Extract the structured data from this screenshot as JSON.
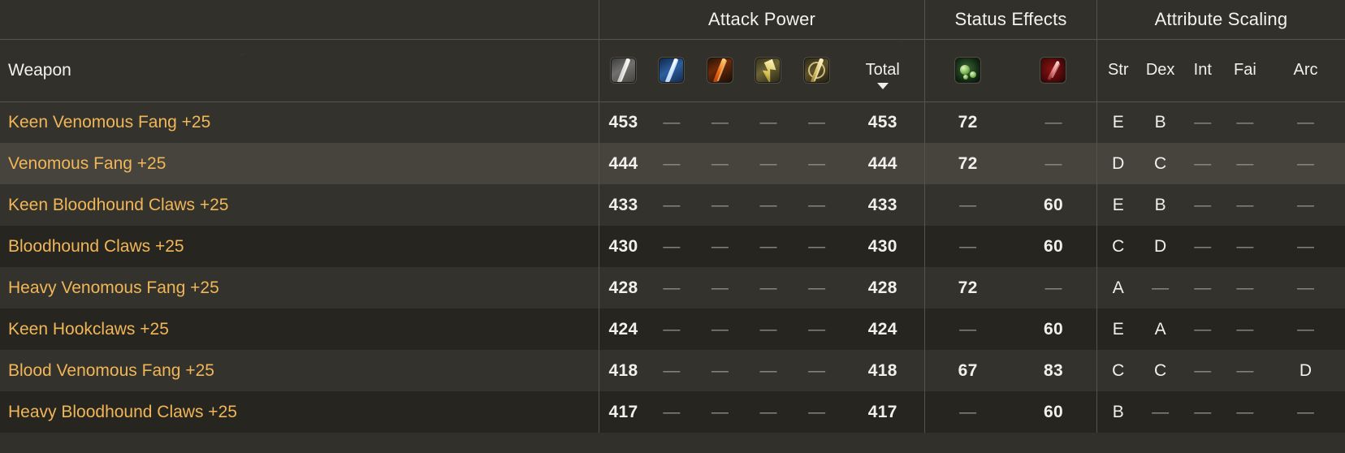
{
  "theme": {
    "background": "#32302a",
    "row_odd": "#34322c",
    "row_even": "#262520",
    "row_hover": "#46443c",
    "border": "#56534a",
    "text": "#f2f0ea",
    "weapon_name": "#f0b657",
    "dash": "#8f8c82"
  },
  "header": {
    "weapon_column_label": "Weapon",
    "groups": [
      {
        "label": "Attack Power"
      },
      {
        "label": "Status Effects"
      },
      {
        "label": "Attribute Scaling"
      }
    ],
    "attack_power_columns": [
      {
        "icon": "physical-damage-icon",
        "label": ""
      },
      {
        "icon": "magic-damage-icon",
        "label": ""
      },
      {
        "icon": "fire-damage-icon",
        "label": ""
      },
      {
        "icon": "lightning-damage-icon",
        "label": ""
      },
      {
        "icon": "holy-damage-icon",
        "label": ""
      },
      {
        "icon": "",
        "label": "Total",
        "sorted": true,
        "sort_direction": "descending"
      }
    ],
    "status_effect_columns": [
      {
        "icon": "poison-status-icon",
        "label": ""
      },
      {
        "icon": "bleed-status-icon",
        "label": ""
      }
    ],
    "attribute_columns": [
      "Str",
      "Dex",
      "Int",
      "Fai",
      "Arc"
    ]
  },
  "rows": [
    {
      "weapon": "Keen Venomous Fang +25",
      "striping": "odd",
      "attack": [
        "453",
        "—",
        "—",
        "—",
        "—"
      ],
      "total": "453",
      "status": [
        "72",
        "—"
      ],
      "scaling": [
        "E",
        "B",
        "—",
        "—",
        "—"
      ]
    },
    {
      "weapon": "Venomous Fang +25",
      "striping": "hover",
      "attack": [
        "444",
        "—",
        "—",
        "—",
        "—"
      ],
      "total": "444",
      "status": [
        "72",
        "—"
      ],
      "scaling": [
        "D",
        "C",
        "—",
        "—",
        "—"
      ]
    },
    {
      "weapon": "Keen Bloodhound Claws +25",
      "striping": "odd",
      "attack": [
        "433",
        "—",
        "—",
        "—",
        "—"
      ],
      "total": "433",
      "status": [
        "—",
        "60"
      ],
      "scaling": [
        "E",
        "B",
        "—",
        "—",
        "—"
      ]
    },
    {
      "weapon": "Bloodhound Claws +25",
      "striping": "even",
      "attack": [
        "430",
        "—",
        "—",
        "—",
        "—"
      ],
      "total": "430",
      "status": [
        "—",
        "60"
      ],
      "scaling": [
        "C",
        "D",
        "—",
        "—",
        "—"
      ]
    },
    {
      "weapon": "Heavy Venomous Fang +25",
      "striping": "odd",
      "attack": [
        "428",
        "—",
        "—",
        "—",
        "—"
      ],
      "total": "428",
      "status": [
        "72",
        "—"
      ],
      "scaling": [
        "A",
        "—",
        "—",
        "—",
        "—"
      ]
    },
    {
      "weapon": "Keen Hookclaws +25",
      "striping": "even",
      "attack": [
        "424",
        "—",
        "—",
        "—",
        "—"
      ],
      "total": "424",
      "status": [
        "—",
        "60"
      ],
      "scaling": [
        "E",
        "A",
        "—",
        "—",
        "—"
      ]
    },
    {
      "weapon": "Blood Venomous Fang +25",
      "striping": "odd",
      "attack": [
        "418",
        "—",
        "—",
        "—",
        "—"
      ],
      "total": "418",
      "status": [
        "67",
        "83"
      ],
      "scaling": [
        "C",
        "C",
        "—",
        "—",
        "D"
      ]
    },
    {
      "weapon": "Heavy Bloodhound Claws +25",
      "striping": "even",
      "attack": [
        "417",
        "—",
        "—",
        "—",
        "—"
      ],
      "total": "417",
      "status": [
        "—",
        "60"
      ],
      "scaling": [
        "B",
        "—",
        "—",
        "—",
        "—"
      ]
    }
  ]
}
